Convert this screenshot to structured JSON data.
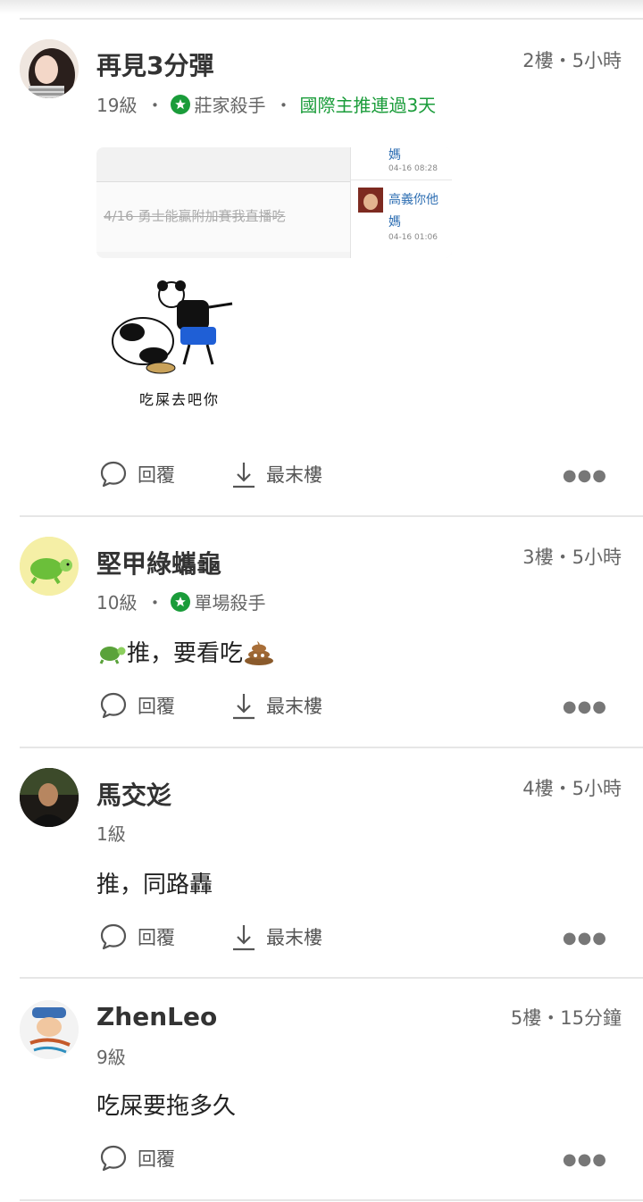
{
  "posts": [
    {
      "name": "再見3分彈",
      "floor": "2樓・5小時",
      "level": "19級",
      "badge": "莊家殺手",
      "tag": "國際主推連過3天",
      "screenshot": {
        "strike_text": "4/16 勇士能贏附加賽我直播吃",
        "top_link": "媽",
        "top_time": "04-16 08:28",
        "mid_link": "高義你他",
        "mid_link2": "媽",
        "mid_time": "04-16 01:06"
      },
      "sticker_caption": "吃屎去吧你",
      "reply": "回覆",
      "last": "最末樓"
    },
    {
      "name": "堅甲綠蠵龜",
      "floor": "3樓・5小時",
      "level": "10級",
      "badge": "單場殺手",
      "content": "推，要看吃",
      "reply": "回覆",
      "last": "最末樓"
    },
    {
      "name": "馬交彣",
      "floor": "4樓・5小時",
      "level": "1級",
      "content": "推，同路轟",
      "reply": "回覆",
      "last": "最末樓"
    },
    {
      "name": "ZhenLeo",
      "floor": "5樓・15分鐘",
      "level": "9級",
      "content": "吃屎要拖多久",
      "reply": "回覆"
    }
  ],
  "icons": {
    "reply": "speech-bubble-icon",
    "last": "download-arrow-icon",
    "more": "more-dots-icon",
    "badge": "star-badge-icon"
  },
  "colors": {
    "accent": "#1a9c3a",
    "link": "#2f6fb3"
  }
}
